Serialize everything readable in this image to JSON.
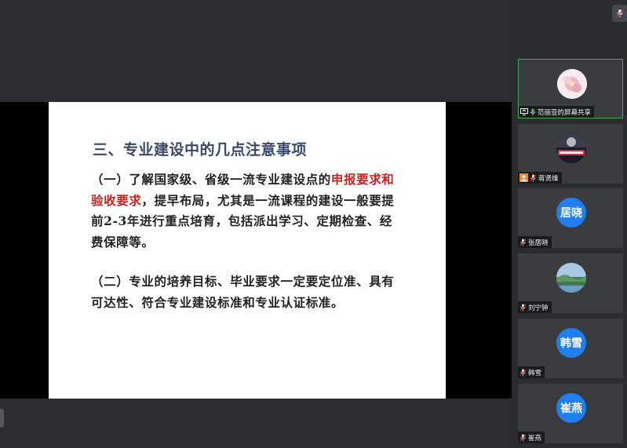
{
  "slide": {
    "title": "三、专业建设中的几点注意事项",
    "paragraph1": {
      "part1": "（一）了解国家级、省级一流专业建设点的",
      "highlight": "申报要求和验收要求",
      "part2": "，提早布局，尤其是一流课程的建设一般要提前2-3年进行重点培育，包括派出学习、定期检查、经费保障等。"
    },
    "paragraph2": "（二）专业的培养目标、毕业要求一定要定位准、具有可达性、符合专业建设标准和专业认证标准。"
  },
  "participants": [
    {
      "name": "范丽亚的屏幕共享",
      "avatar_text": "",
      "avatar_type": "flower-photo",
      "sharing": true,
      "mic": "on"
    },
    {
      "name": "蒋贤维",
      "avatar_text": "",
      "avatar_type": "racing-photo",
      "sharing": false,
      "mic": "muted"
    },
    {
      "name": "张居晓",
      "avatar_text": "居晓",
      "avatar_type": "initials",
      "sharing": false,
      "mic": "muted"
    },
    {
      "name": "刘宁钟",
      "avatar_text": "",
      "avatar_type": "landscape-photo",
      "sharing": false,
      "mic": "muted"
    },
    {
      "name": "韩雪",
      "avatar_text": "韩雪",
      "avatar_type": "initials",
      "sharing": false,
      "mic": "muted"
    },
    {
      "name": "崔燕",
      "avatar_text": "崔燕",
      "avatar_type": "initials",
      "sharing": false,
      "mic": "muted"
    }
  ],
  "colors": {
    "active_border": "#3fa950",
    "avatar_blue": "#1f7ef0",
    "highlight_red": "#d21e1e",
    "title_color": "#3a4a6a"
  },
  "icons": {
    "top_button": "mic-muted-icon",
    "screen_share": "screen-share-icon",
    "mic_on": "mic-icon",
    "mic_muted": "mic-muted-icon",
    "user": "user-icon"
  }
}
